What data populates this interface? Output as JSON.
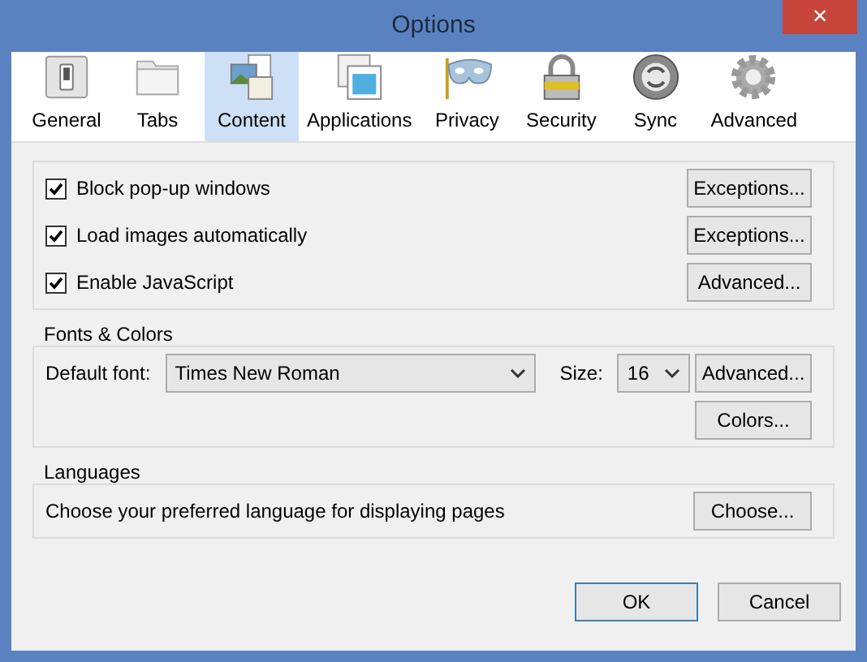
{
  "window": {
    "title": "Options",
    "close": "×"
  },
  "tabs": [
    {
      "label": "General",
      "selected": false
    },
    {
      "label": "Tabs",
      "selected": false
    },
    {
      "label": "Content",
      "selected": true
    },
    {
      "label": "Applications",
      "selected": false
    },
    {
      "label": "Privacy",
      "selected": false
    },
    {
      "label": "Security",
      "selected": false
    },
    {
      "label": "Sync",
      "selected": false
    },
    {
      "label": "Advanced",
      "selected": false
    }
  ],
  "content_options": [
    {
      "label": "Block pop-up windows",
      "checked": true,
      "button": "Exceptions..."
    },
    {
      "label": "Load images automatically",
      "checked": true,
      "button": "Exceptions..."
    },
    {
      "label": "Enable JavaScript",
      "checked": true,
      "button": "Advanced..."
    }
  ],
  "fonts_colors": {
    "title": "Fonts & Colors",
    "default_font_label": "Default font:",
    "default_font": "Times New Roman",
    "size_label": "Size:",
    "size": "16",
    "advanced_button": "Advanced...",
    "colors_button": "Colors..."
  },
  "languages": {
    "title": "Languages",
    "description": "Choose your preferred language for displaying pages",
    "choose_button": "Choose..."
  },
  "buttons": [
    {
      "label": "OK",
      "default": true
    },
    {
      "label": "Cancel",
      "default": false
    }
  ]
}
